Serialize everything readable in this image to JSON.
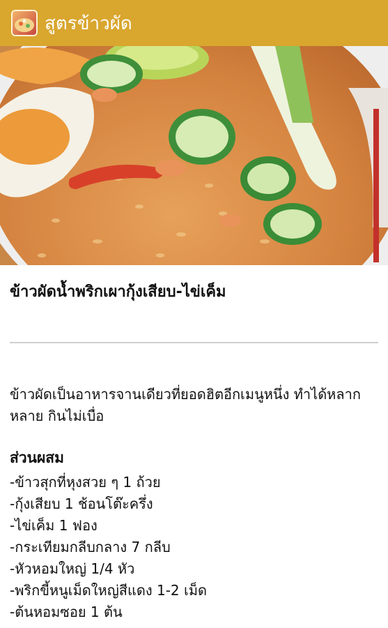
{
  "app": {
    "title": "สูตรข้าวผัด",
    "icon": "fried-rice-app-icon",
    "bar_color": "#d9a62e"
  },
  "hero": {
    "image": "fried-rice-dish-photo"
  },
  "recipe": {
    "title": "ข้าวผัดน้ำพริกเผากุ้งเสียบ-ไข่เค็ม",
    "description": "ข้าวผัดเป็นอาหารจานเดียวที่ยอดฮิตอีกเมนูหนึ่ง ทำได้หลากหลาย กินไม่เบื่อ",
    "ingredients_heading": "ส่วนผสม",
    "ingredients": [
      "-ข้าวสุกที่หุงสวย ๆ 1 ถ้วย",
      "-กุ้งเสียบ 1 ช้อนโต๊ะครึ่ง",
      "-ไข่เค็ม 1 ฟอง",
      "-กระเทียมกลีบกลาง 7 กลีบ",
      "-หัวหอมใหญ่ 1/4 หัว",
      "-พริกขี้หนูเม็ดใหญ่สีแดง 1-2 เม็ด",
      "-ต้นหอมซอย 1 ต้น"
    ]
  }
}
